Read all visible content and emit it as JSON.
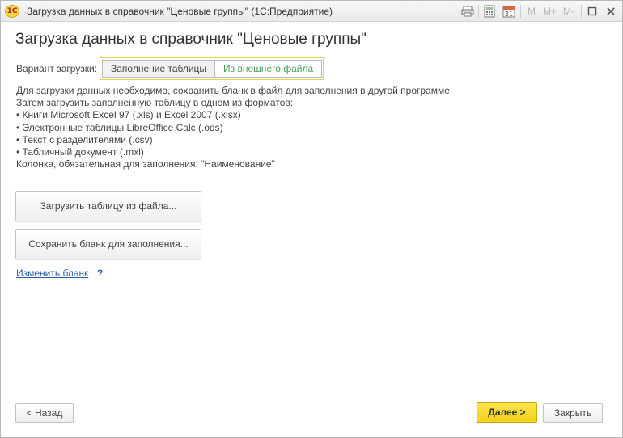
{
  "window": {
    "app_logo": "1С",
    "title": "Загрузка данных в справочник \"Ценовые группы\"  (1С:Предприятие)",
    "icons": [
      "printer-icon",
      "calculator-icon",
      "calendar-icon"
    ],
    "calendar_day": "31",
    "memory": [
      "M",
      "M+",
      "M-"
    ]
  },
  "page": {
    "title": "Загрузка данных в справочник \"Ценовые группы\""
  },
  "variant": {
    "label": "Вариант загрузки:",
    "options": [
      "Заполнение таблицы",
      "Из внешнего файла"
    ],
    "selected": "Из внешнего файла"
  },
  "info": {
    "lines": [
      "Для загрузки данных необходимо, сохранить бланк в файл для заполнения в другой программе.",
      "Затем загрузить заполненную таблицу в одном из форматов:",
      "• Книги Microsoft Excel 97 (.xls) и Excel 2007 (.xlsx)",
      "• Электронные таблицы LibreOffice Calc (.ods)",
      "• Текст с разделителями (.csv)",
      "• Табличный документ (.mxl)",
      "Колонка, обязательная для заполнения: \"Наименование\""
    ]
  },
  "actions": {
    "load_table": "Загрузить таблицу из файла...",
    "save_form": "Сохранить бланк для заполнения...",
    "change_form": "Изменить бланк",
    "help": "?"
  },
  "footer": {
    "back": "< Назад",
    "next": "Далее >",
    "close": "Закрыть"
  },
  "colors": {
    "accent_yellow": "#f3d219",
    "link_blue": "#2a5ea8",
    "active_option_green": "#4aa05a"
  }
}
